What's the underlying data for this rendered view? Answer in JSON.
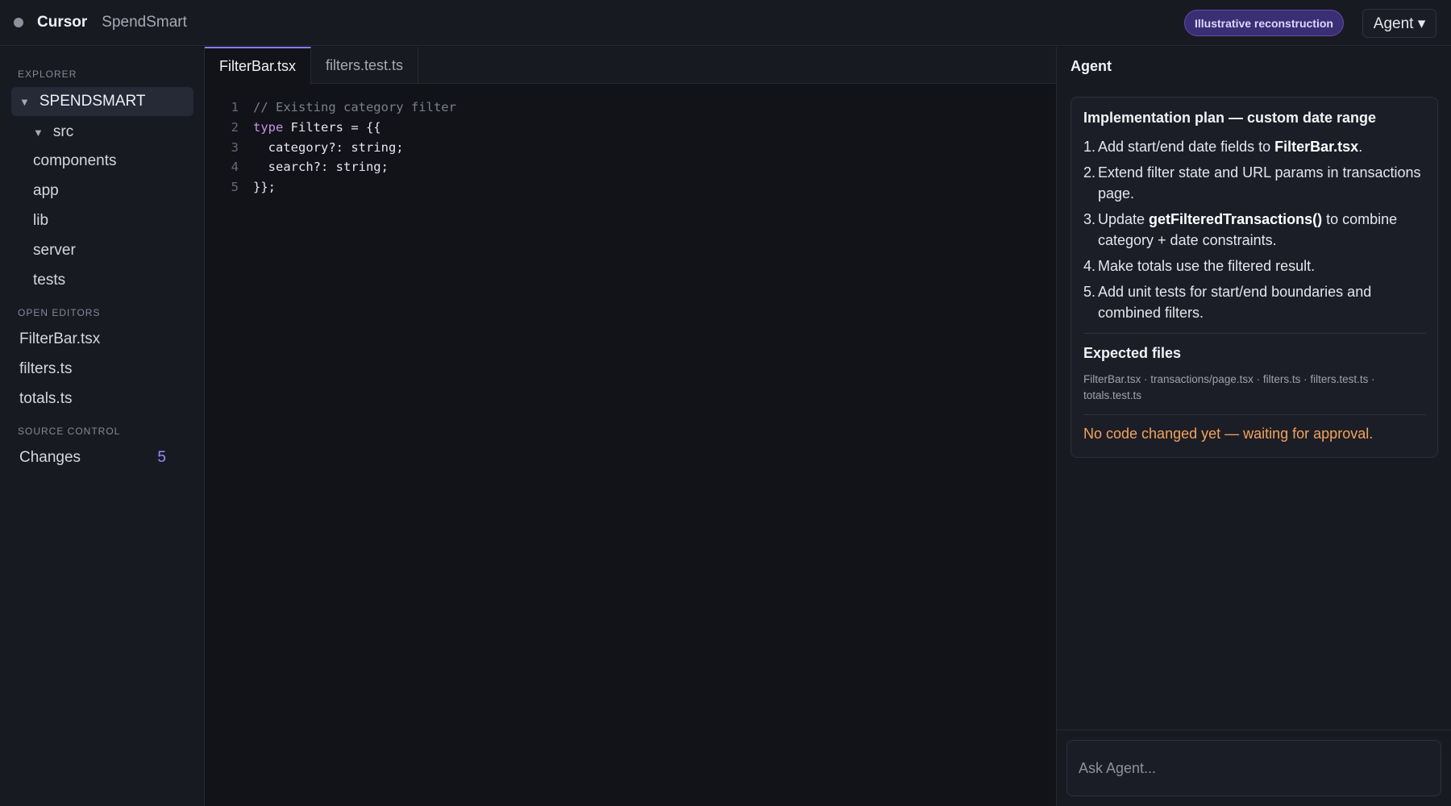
{
  "titlebar": {
    "app_name": "Cursor",
    "project_name": "SpendSmart",
    "badge": "Illustrative reconstruction",
    "mode_select": "Agent ▾"
  },
  "sidebar": {
    "explorer_label": "EXPLORER",
    "root": "SPENDSMART",
    "src_folder": "src",
    "folders": [
      "components",
      "app",
      "lib",
      "server",
      "tests"
    ],
    "open_editors_label": "OPEN EDITORS",
    "open_editors": [
      "FilterBar.tsx",
      "filters.ts",
      "totals.ts"
    ],
    "source_control_label": "SOURCE CONTROL",
    "changes_label": "Changes",
    "changes_count": "5"
  },
  "editor": {
    "tabs": [
      {
        "label": "FilterBar.tsx",
        "active": true
      },
      {
        "label": "filters.test.ts",
        "active": false
      }
    ],
    "lines": [
      {
        "num": "1",
        "text": "// Existing category filter"
      },
      {
        "num": "2",
        "kw": "type",
        "text": " Filters = {{"
      },
      {
        "num": "3",
        "text": "  category?: string;"
      },
      {
        "num": "4",
        "text": "  search?: string;"
      },
      {
        "num": "5",
        "text": "}};"
      }
    ]
  },
  "agent": {
    "title": "Agent",
    "plan_title": "Implementation plan — custom date range",
    "steps": [
      {
        "num": "1.",
        "before": "Add start/end date fields to ",
        "bold": "FilterBar.tsx",
        "after": "."
      },
      {
        "num": "2.",
        "before": "Extend filter state and URL params in transactions page.",
        "bold": "",
        "after": ""
      },
      {
        "num": "3.",
        "before": "Update ",
        "bold": "getFilteredTransactions()",
        "after": " to combine category + date constraints."
      },
      {
        "num": "4.",
        "before": "Make totals use the filtered result.",
        "bold": "",
        "after": ""
      },
      {
        "num": "5.",
        "before": "Add unit tests for start/end boundaries and combined filters.",
        "bold": "",
        "after": ""
      }
    ],
    "files_title": "Expected files",
    "files": "FilterBar.tsx · transactions/page.tsx · filters.ts · filters.test.ts · totals.test.ts",
    "status": "No code changed yet — waiting for approval.",
    "ask_placeholder": "Ask Agent..."
  }
}
